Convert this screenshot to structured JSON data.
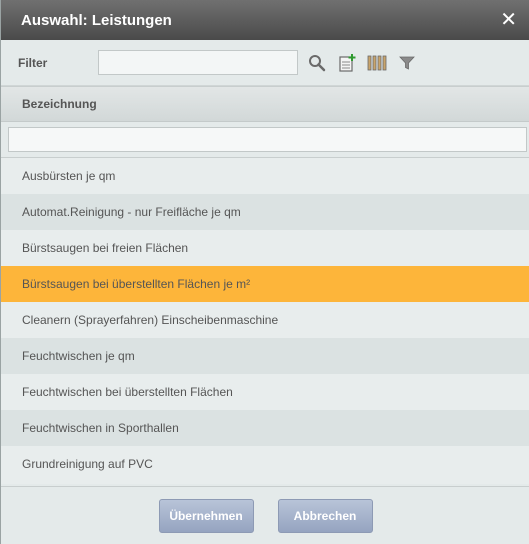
{
  "dialog": {
    "title": "Auswahl: Leistungen",
    "close_glyph": "✕"
  },
  "filter": {
    "label": "Filter",
    "value": "",
    "placeholder": "",
    "icons": [
      "search-icon",
      "add-document-icon",
      "columns-icon",
      "funnel-icon"
    ]
  },
  "table": {
    "column_header": "Bezeichnung",
    "column_filter_value": "",
    "rows": [
      {
        "label": "Ausbürsten je qm",
        "selected": false
      },
      {
        "label": "Automat.Reinigung - nur Freifläche je qm",
        "selected": false
      },
      {
        "label": "Bürstsaugen bei freien Flächen",
        "selected": false
      },
      {
        "label": "Bürstsaugen bei überstellten Flächen je m²",
        "selected": true
      },
      {
        "label": "Cleanern (Sprayerfahren) Einscheibenmaschine",
        "selected": false
      },
      {
        "label": "Feuchtwischen je qm",
        "selected": false
      },
      {
        "label": "Feuchtwischen bei überstellten Flächen",
        "selected": false
      },
      {
        "label": "Feuchtwischen in Sporthallen",
        "selected": false
      },
      {
        "label": "Grundreinigung auf PVC",
        "selected": false
      }
    ]
  },
  "footer": {
    "ok_label": "Übernehmen",
    "cancel_label": "Abbrechen"
  },
  "colors": {
    "selection": "#fdb53a",
    "titlebar": "#5a5a5a",
    "button": "#a6b3cb"
  }
}
